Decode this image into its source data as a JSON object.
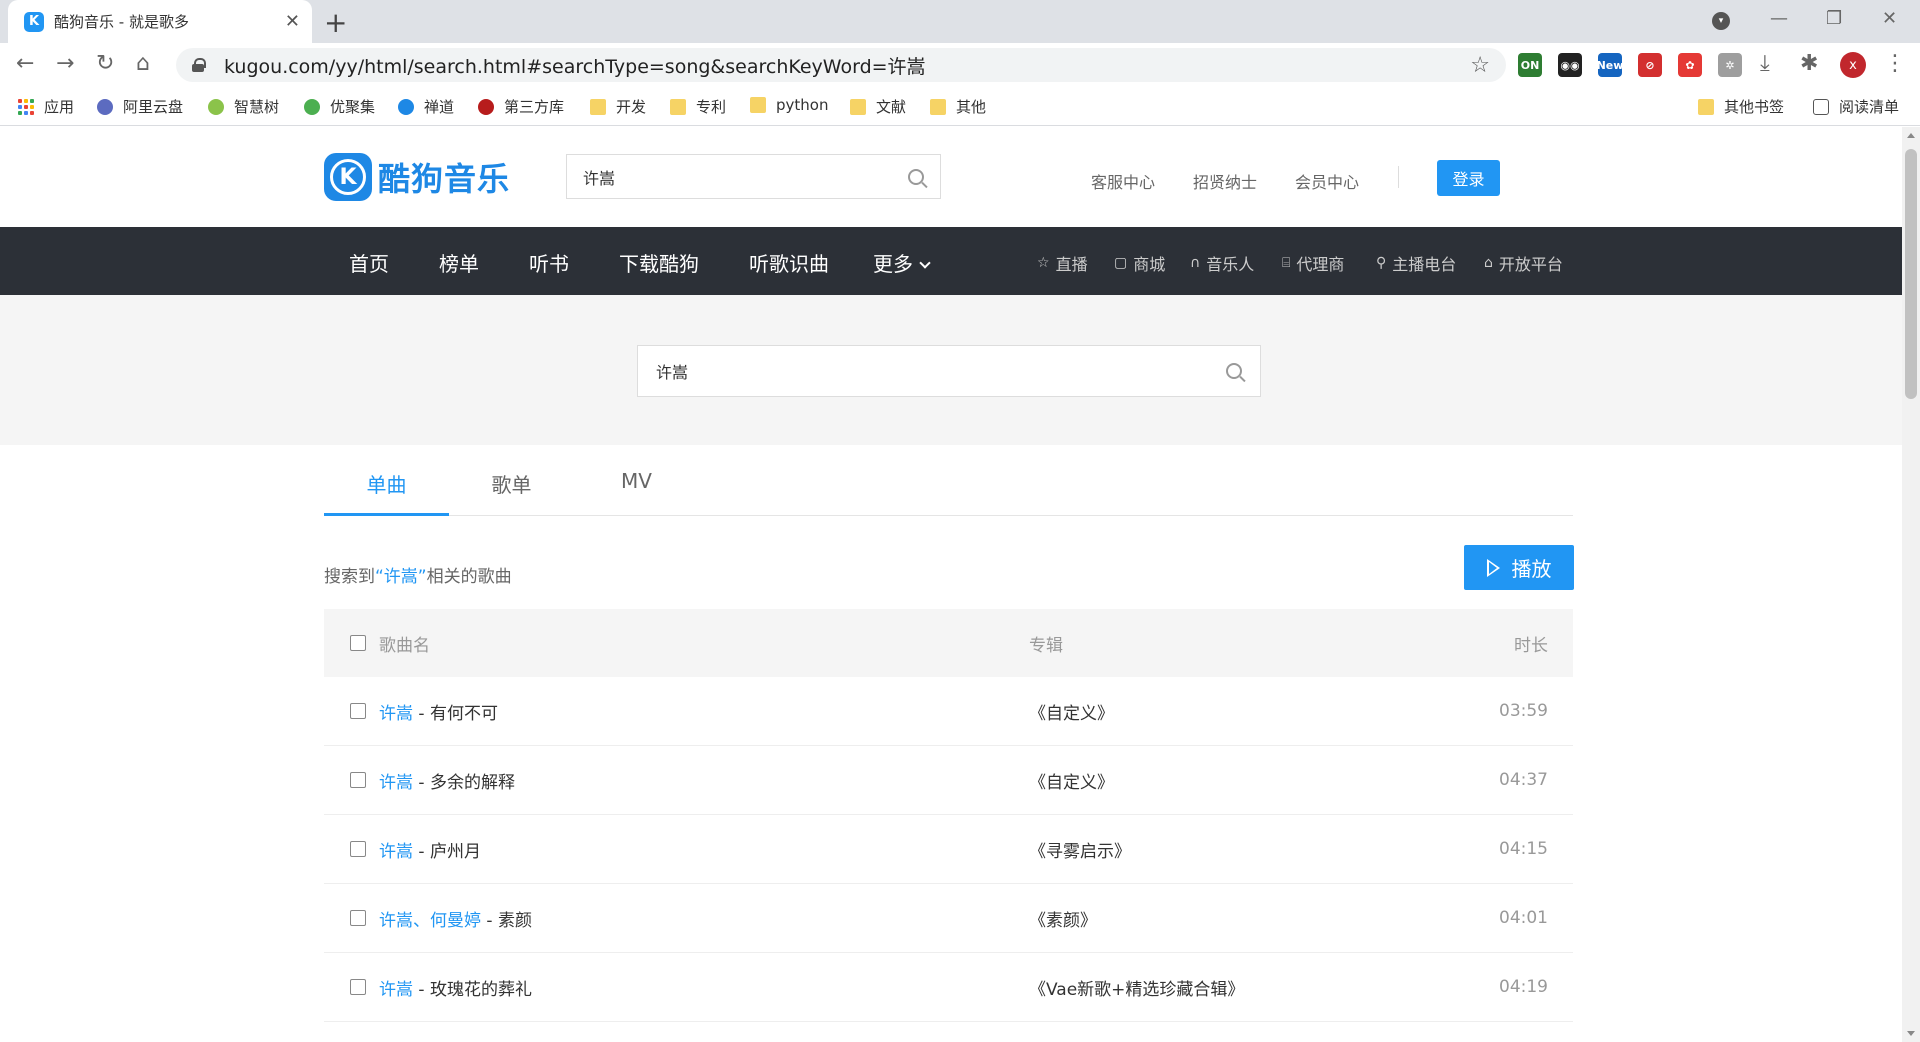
{
  "browser": {
    "tab_title": "酷狗音乐 - 就是歌多",
    "tab_favicon": "K",
    "url": "kugou.com/yy/html/search.html#searchType=song&searchKeyWord=许嵩",
    "avatar_letter": "x",
    "extensions": [
      {
        "name": "on-ext",
        "label": "ON",
        "color": "#2e7d32"
      },
      {
        "name": "binoculars-ext",
        "label": "◉◉",
        "color": "#222222"
      },
      {
        "name": "new-ext",
        "label": "New",
        "color": "#1565c0"
      },
      {
        "name": "blocked-ext",
        "label": "⊘",
        "color": "#d32f2f"
      },
      {
        "name": "red-ext",
        "label": "✿",
        "color": "#e53935"
      },
      {
        "name": "gray-ext",
        "label": "✲",
        "color": "#9e9e9e"
      }
    ]
  },
  "bookmarks": [
    {
      "label": "应用",
      "type": "apps"
    },
    {
      "label": "阿里云盘",
      "type": "site",
      "color": "#5c6bc0"
    },
    {
      "label": "智慧树",
      "type": "site",
      "color": "#8bc34a"
    },
    {
      "label": "优聚集",
      "type": "site",
      "color": "#4caf50"
    },
    {
      "label": "禅道",
      "type": "site",
      "color": "#1e88e5"
    },
    {
      "label": "第三方库",
      "type": "site",
      "color": "#b71c1c"
    },
    {
      "label": "开发",
      "type": "folder"
    },
    {
      "label": "专利",
      "type": "folder"
    },
    {
      "label": "python",
      "type": "folder"
    },
    {
      "label": "文献",
      "type": "folder"
    },
    {
      "label": "其他",
      "type": "folder"
    }
  ],
  "bookmarks_right": {
    "other": "其他书签",
    "reading": "阅读清单"
  },
  "site": {
    "logo_text": "酷狗音乐",
    "header_search_value": "许嵩",
    "header_links": [
      "客服中心",
      "招贤纳士",
      "会员中心"
    ],
    "login": "登录",
    "nav": [
      "首页",
      "榜单",
      "听书",
      "下载酷狗",
      "听歌识曲",
      "更多"
    ],
    "nav_sub": [
      {
        "icon": "☆",
        "label": "直播"
      },
      {
        "icon": "▢",
        "label": "商城"
      },
      {
        "icon": "∩",
        "label": "音乐人"
      },
      {
        "icon": "⌸",
        "label": "代理商"
      },
      {
        "icon": "⚲",
        "label": "主播电台"
      },
      {
        "icon": "⌂",
        "label": "开放平台"
      }
    ],
    "main_search_value": "许嵩"
  },
  "results": {
    "tabs": [
      "单曲",
      "歌单",
      "MV"
    ],
    "active_tab": 0,
    "prefix": "搜索到",
    "keyword": "“许嵩”",
    "suffix": "相关的歌曲",
    "play": "播放",
    "columns": {
      "name": "歌曲名",
      "album": "专辑",
      "duration": "时长"
    },
    "songs": [
      {
        "singers": "许嵩",
        "extra_singers": "",
        "title": "有何不可",
        "album": "《自定义》",
        "duration": "03:59"
      },
      {
        "singers": "许嵩",
        "extra_singers": "",
        "title": "多余的解释",
        "album": "《自定义》",
        "duration": "04:37"
      },
      {
        "singers": "许嵩",
        "extra_singers": "",
        "title": "庐州月",
        "album": "《寻雾启示》",
        "duration": "04:15"
      },
      {
        "singers": "许嵩",
        "extra_singers": "、何曼婷",
        "title": "素颜",
        "album": "《素颜》",
        "duration": "04:01"
      },
      {
        "singers": "许嵩",
        "extra_singers": "",
        "title": "玫瑰花的葬礼",
        "album": "《Vae新歌+精选珍藏合辑》",
        "duration": "04:19"
      }
    ]
  }
}
